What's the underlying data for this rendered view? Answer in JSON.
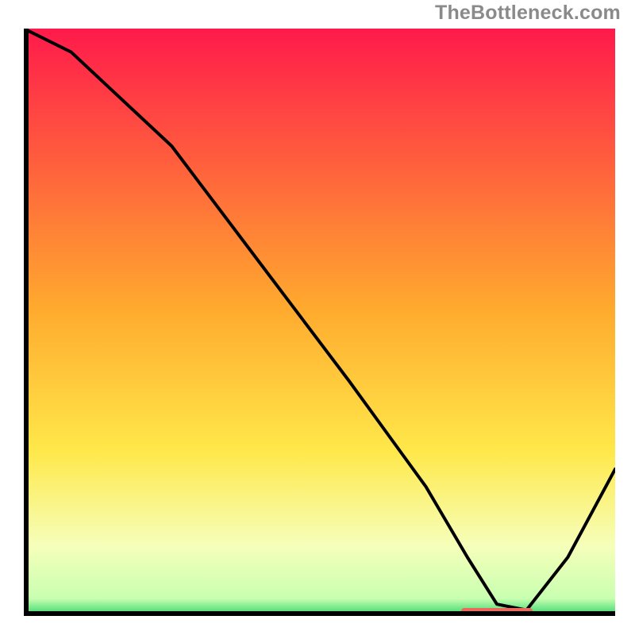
{
  "watermark": "TheBottleneck.com",
  "colors": {
    "gradient_top": "#ff1a4b",
    "gradient_mid": "#ffcc33",
    "gradient_low": "#f8ffb0",
    "gradient_bottom": "#2fd36a",
    "line": "#000000",
    "marker": "#e96a5c",
    "axis": "#000000",
    "watermark": "#8a8a8a"
  },
  "chart_data": {
    "type": "line",
    "title": "",
    "xlabel": "",
    "ylabel": "",
    "xlim": [
      0,
      100
    ],
    "ylim": [
      0,
      100
    ],
    "x": [
      0,
      8,
      25,
      40,
      55,
      68,
      75,
      80,
      85,
      92,
      100
    ],
    "values": [
      100,
      96,
      80,
      60,
      40,
      22,
      10,
      2,
      1,
      10,
      25
    ],
    "notes": "Values estimated from pixel heights; axes unlabeled in source image.",
    "marker": {
      "x_start": 74,
      "x_end": 86,
      "y": 0.8
    }
  }
}
